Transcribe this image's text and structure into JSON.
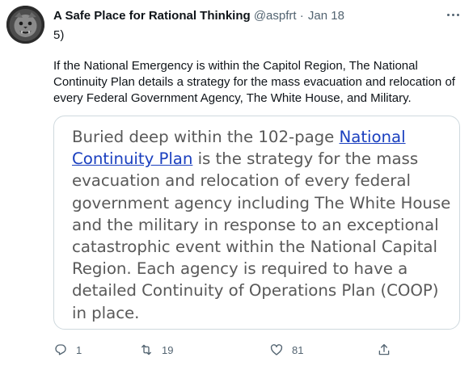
{
  "author": {
    "display_name": "A Safe Place for Rational Thinking",
    "handle": "@aspfrt",
    "separator": "·",
    "date": "Jan 18"
  },
  "thread_number": "5)",
  "body": "If the National Emergency is within the Capitol Region, The National Continuity Plan details a strategy for the mass evacuation and relocation of every Federal Government Agency, The White House, and Military.",
  "media": {
    "quote_before": "Buried deep within the 102-page ",
    "quote_link": "National Continuity Plan",
    "quote_after": " is the strategy for the mass evacuation and relocation of every federal government agency including The White House and the military in response to an exceptional catastrophic event within the National Capital Region. Each agency is required to have a detailed Continuity of Operations Plan (COOP) in place."
  },
  "actions": {
    "reply_icon": "reply-icon",
    "reply_count": "1",
    "retweet_icon": "retweet-icon",
    "retweet_count": "19",
    "like_icon": "heart-icon",
    "like_count": "81",
    "share_icon": "share-icon"
  },
  "colors": {
    "text": "#0f1419",
    "secondary": "#536471",
    "border": "#cfd9de",
    "quote_text": "#595959",
    "link": "#1a3fbf"
  }
}
